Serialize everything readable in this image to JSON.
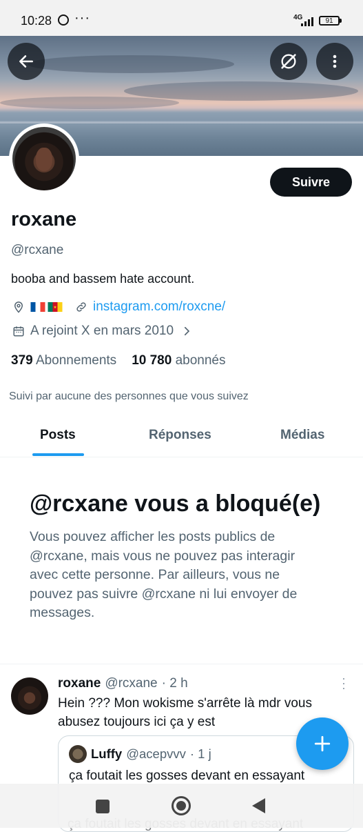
{
  "status_bar": {
    "time": "10:28",
    "network": "4G",
    "battery": "91"
  },
  "profile": {
    "follow_label": "Suivre",
    "name": "roxane",
    "handle": "@rcxane",
    "bio": "booba and bassem hate account.",
    "link": "instagram.com/roxcne/",
    "joined": "A rejoint X en mars 2010",
    "following_count": "379",
    "following_label": "Abonnements",
    "followers_count": "10 780",
    "followers_label": "abonnés",
    "followed_by": "Suivi par aucune des personnes que vous suivez"
  },
  "tabs": [
    {
      "label": "Posts"
    },
    {
      "label": "Réponses"
    },
    {
      "label": "Médias"
    }
  ],
  "blocked": {
    "title": "@rcxane vous a bloqué(e)",
    "body": "Vous pouvez afficher les posts publics de @rcxane, mais vous ne pouvez pas interagir avec cette personne. Par ailleurs, vous ne pouvez pas suivre @rcxane ni lui envoyer de messages."
  },
  "post": {
    "name": "roxane",
    "handle": "@rcxane",
    "time": "· 2 h",
    "text": "Hein ??? Mon wokisme s'arrête là mdr vous abusez toujours ici ça y est",
    "quote": {
      "name": "Luffy",
      "handle": "@acepvvv",
      "time": "· 1 j",
      "text": "ça foutait les gosses devant en essayant",
      "text_ghost": "ça foutait les gosses devant en essayant"
    }
  },
  "colors": {
    "accent": "#1d9bf0",
    "text": "#0f1419",
    "secondary": "#536471"
  }
}
